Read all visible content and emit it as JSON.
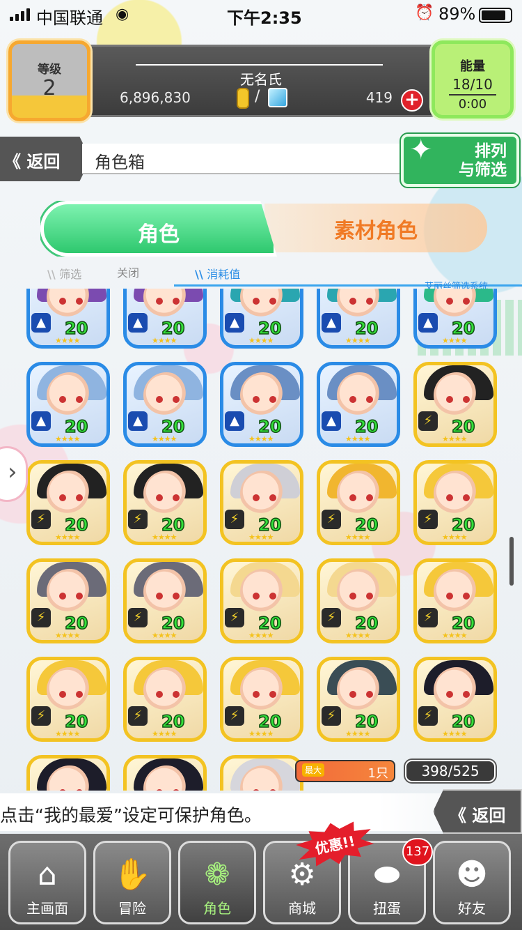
{
  "status_bar": {
    "carrier": "中国联通",
    "time": "下午2:35",
    "battery": "89%"
  },
  "header": {
    "level_label": "等级",
    "level_value": "2",
    "username": "无名氏",
    "coins": "6,896,830",
    "gems": "419",
    "add_label": "+",
    "energy_label": "能量",
    "energy_value": "18/10",
    "energy_timer": "0:00"
  },
  "nav_top": {
    "back_label": "返回",
    "page_title": "角色箱",
    "sort_label_1": "排列",
    "sort_label_2": "与筛选"
  },
  "tabs": [
    {
      "label": "角色",
      "active": true
    },
    {
      "label": "素材角色",
      "active": false
    }
  ],
  "filters": {
    "filter_label": "筛选",
    "filter_state": "关闭",
    "sort_key": "消耗值",
    "system_label": "艾丽丝筛选系统"
  },
  "characters": {
    "level": "20",
    "rows": [
      [
        "water",
        "water",
        "water",
        "water",
        "water"
      ],
      [
        "water",
        "water",
        "water",
        "water",
        "thunder"
      ],
      [
        "thunder",
        "thunder",
        "thunder",
        "thunder",
        "thunder"
      ],
      [
        "thunder",
        "thunder",
        "thunder",
        "thunder",
        "thunder"
      ],
      [
        "thunder",
        "thunder",
        "thunder",
        "thunder",
        "thunder"
      ],
      [
        "thunder",
        "thunder",
        "thunder",
        "",
        ""
      ]
    ]
  },
  "capacity": {
    "max_label": "最大",
    "max_value": "1只",
    "count": "398/525"
  },
  "tip": {
    "text": "点击“我的最爱”设定可保护角色。",
    "back_label": "返回"
  },
  "bottom_nav": {
    "items": [
      {
        "label": "主画面",
        "icon": "home-icon"
      },
      {
        "label": "冒险",
        "icon": "handshake-icon"
      },
      {
        "label": "角色",
        "icon": "rabbit-icon"
      },
      {
        "label": "商城",
        "icon": "cart-icon"
      },
      {
        "label": "扭蛋",
        "icon": "egg-icon"
      },
      {
        "label": "好友",
        "icon": "friends-icon"
      }
    ],
    "promo": "优惠!!",
    "gacha_badge": "137"
  }
}
